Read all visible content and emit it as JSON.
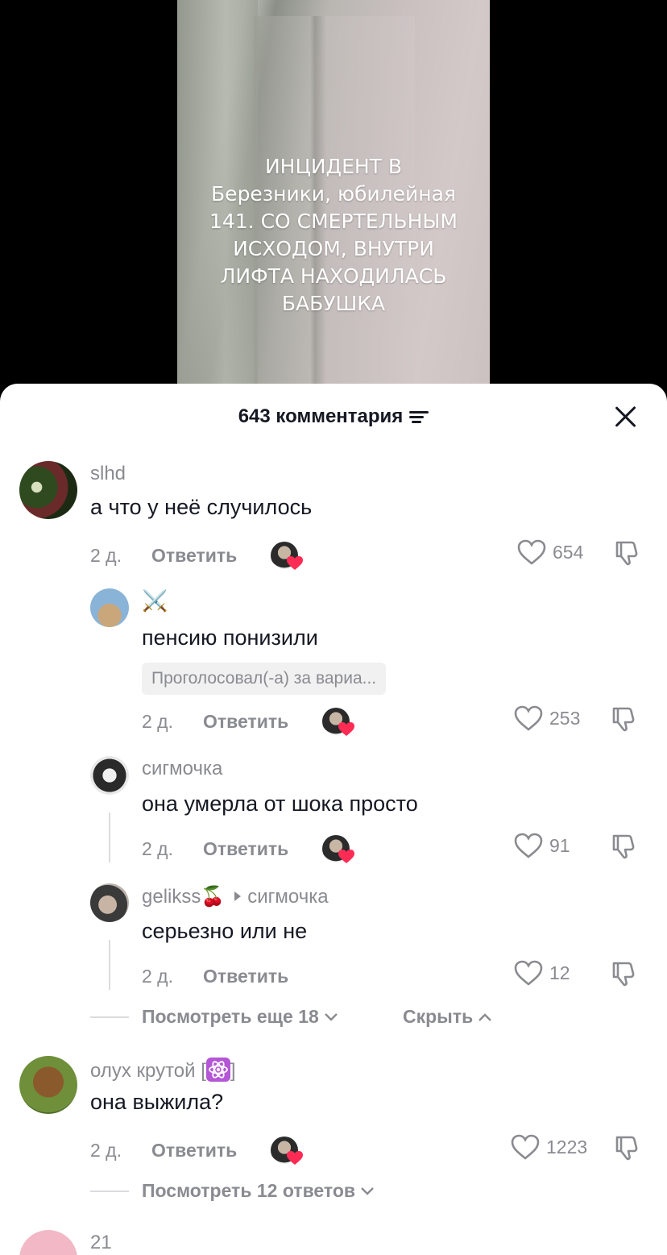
{
  "video": {
    "caption_lines": [
      "ИНЦИДЕНТ В",
      "Березники, юбилейная",
      "141. СО СМЕРТЕЛЬНЫМ",
      "ИСХОДОМ, ВНУТРИ",
      "ЛИФТА НАХОДИЛАСЬ",
      "БАБУШКА"
    ]
  },
  "header": {
    "title": "643 комментария"
  },
  "comments": [
    {
      "username": "slhd",
      "text": "а что у неё случилось",
      "time": "2 д.",
      "reply_label": "Ответить",
      "likes": "654"
    },
    {
      "username": "⚔️",
      "text": "пенсию понизили",
      "poll": "Проголосовал(-а) за вариа...",
      "time": "2 д.",
      "reply_label": "Ответить",
      "likes": "253"
    },
    {
      "username": "сигмочка",
      "text": "она умерла от шока просто",
      "time": "2 д.",
      "reply_label": "Ответить",
      "likes": "91"
    },
    {
      "username": "gelikss🍒",
      "reply_to": "сигмочка",
      "text": "серьезно или не",
      "time": "2 д.",
      "reply_label": "Ответить",
      "likes": "12"
    },
    {
      "username_prefix": "олух крутой [",
      "username_suffix": "]",
      "text": "она выжила?",
      "time": "2 д.",
      "reply_label": "Ответить",
      "likes": "1223"
    }
  ],
  "thread1": {
    "view_more": "Посмотреть еще 18",
    "hide": "Скрыть"
  },
  "thread2": {
    "view_replies": "Посмотреть 12 ответов"
  },
  "partial_next": {
    "username": "21"
  },
  "colors": {
    "text_primary": "#161823",
    "text_secondary": "#8a8b91",
    "creator_heart": "#fe2c55"
  }
}
